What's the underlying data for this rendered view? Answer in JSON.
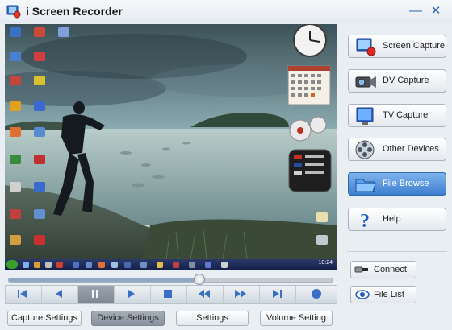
{
  "window": {
    "title": "i Screen Recorder",
    "minimize_glyph": "—",
    "close_glyph": "✕"
  },
  "preview": {
    "taskbar_time": "10:24"
  },
  "sidebar": {
    "items": [
      {
        "label": "Screen Capture",
        "icon": "screen-capture-icon",
        "active": false
      },
      {
        "label": "DV Capture",
        "icon": "dv-camera-icon",
        "active": false
      },
      {
        "label": "TV Capture",
        "icon": "tv-icon",
        "active": false
      },
      {
        "label": "Other Devices",
        "icon": "film-reel-icon",
        "active": false
      },
      {
        "label": "File Browse",
        "icon": "folder-icon",
        "active": true
      },
      {
        "label": "Help",
        "icon": "help-icon",
        "active": false
      }
    ]
  },
  "actions": {
    "connect_label": "Connect",
    "file_list_label": "File List"
  },
  "transport": {
    "position": 0.59,
    "buttons": [
      {
        "name": "skip-start",
        "icon": "skip-start-icon"
      },
      {
        "name": "previous",
        "icon": "previous-icon"
      },
      {
        "name": "pause",
        "icon": "pause-icon",
        "pressed": true
      },
      {
        "name": "play",
        "icon": "play-icon"
      },
      {
        "name": "stop",
        "icon": "stop-icon"
      },
      {
        "name": "rewind",
        "icon": "rewind-icon"
      },
      {
        "name": "fast-forward",
        "icon": "fast-forward-icon"
      },
      {
        "name": "skip-end",
        "icon": "skip-end-icon"
      },
      {
        "name": "record",
        "icon": "record-icon"
      }
    ]
  },
  "bottom_tabs": {
    "capture_settings": "Capture Settings",
    "device_settings": "Device Settings",
    "settings": "Settings",
    "volume_setting": "Volume Setting",
    "active": "Device Settings"
  },
  "colors": {
    "accent": "#3d7ed0",
    "title_text": "#1b1b1b",
    "window_bg": "#e9eef3"
  }
}
